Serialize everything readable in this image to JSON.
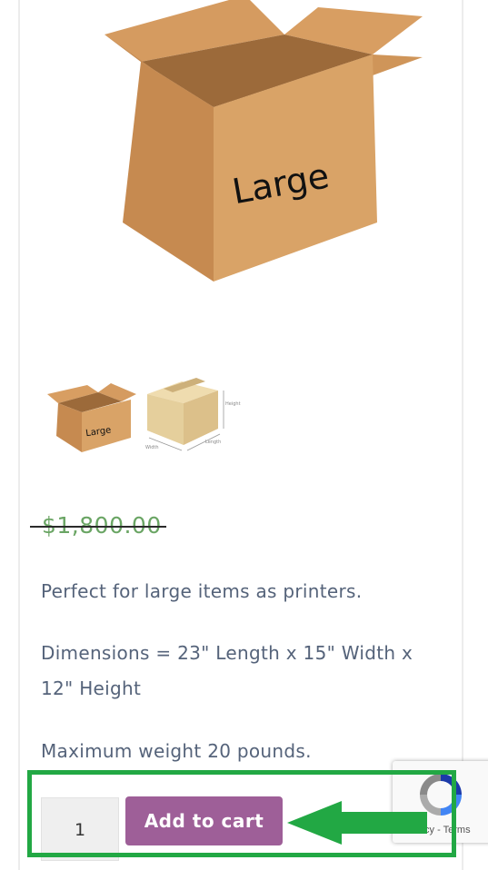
{
  "product": {
    "main_image_label": "Large",
    "thumbnails": [
      {
        "label": "Large"
      },
      {
        "labels": [
          "Height",
          "Width",
          "Length"
        ]
      }
    ],
    "price": "$1,800.00",
    "description": [
      "Perfect for large items as printers.",
      "Dimensions = 23\" Length x 15\" Width x",
      "12\" Height",
      "Maximum weight 20 pounds."
    ]
  },
  "cart": {
    "quantity": "1",
    "add_to_cart_label": "Add to cart"
  },
  "recaptcha": {
    "privacy": "Privacy",
    "separator": "-",
    "terms": "Terms"
  },
  "colors": {
    "price": "#6aa564",
    "button": "#9e5f98",
    "highlight": "#22a844",
    "text": "#55637a"
  },
  "icons": {
    "recaptcha": "recaptcha-icon",
    "arrow": "arrow-left-icon"
  }
}
